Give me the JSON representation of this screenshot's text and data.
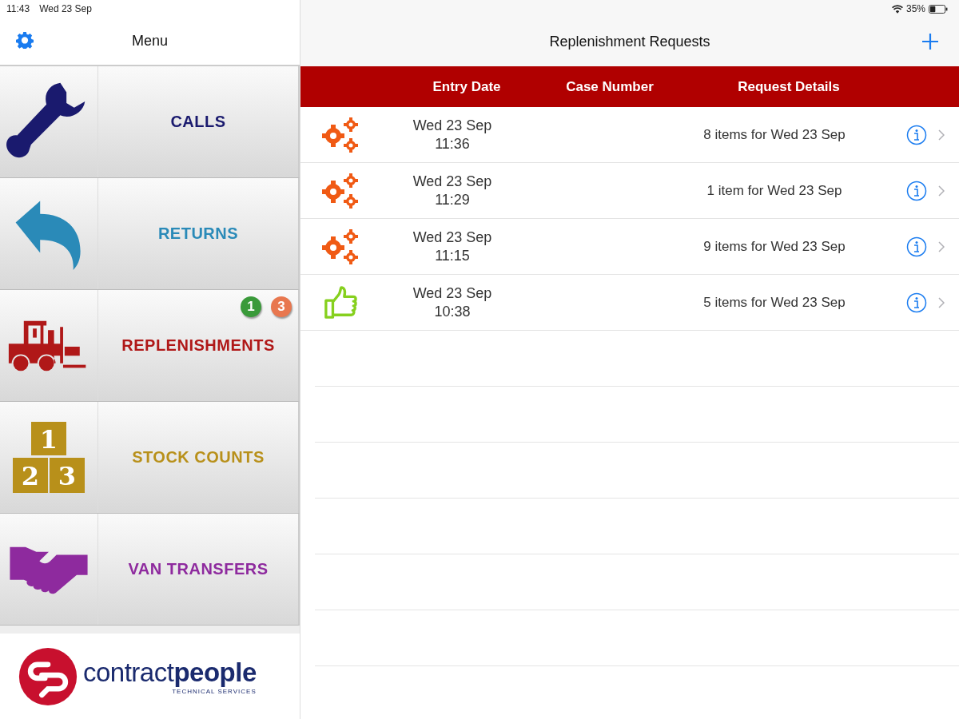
{
  "status_bar": {
    "time": "11:43",
    "date": "Wed 23 Sep",
    "battery": "35%"
  },
  "sidebar": {
    "title": "Menu",
    "items": [
      {
        "kind": "calls",
        "label": "CALLS",
        "color": "#1a1a6e"
      },
      {
        "kind": "returns",
        "label": "RETURNS",
        "color": "#2a8ab8"
      },
      {
        "kind": "replenishments",
        "label": "REPLENISHMENTS",
        "color": "#b01818",
        "badges": [
          {
            "text": "1",
            "color": "#3a9a3a"
          },
          {
            "text": "3",
            "color": "#e8774f"
          }
        ]
      },
      {
        "kind": "stock",
        "label": "STOCK COUNTS",
        "color": "#b8901a",
        "digits": [
          "1",
          "2",
          "3"
        ]
      },
      {
        "kind": "transfers",
        "label": "VAN TRANSFERS",
        "color": "#8e2a9e"
      }
    ],
    "logo": {
      "name": "contract**people**",
      "tagline": "TECHNICAL SERVICES"
    }
  },
  "main": {
    "title": "Replenishment Requests",
    "table": {
      "columns": [
        "Entry Date",
        "Case Number",
        "Request Details"
      ],
      "rows": [
        {
          "kind": "processing",
          "date": "Wed 23 Sep",
          "time": "11:36",
          "details": "8 items for Wed 23 Sep"
        },
        {
          "kind": "processing",
          "date": "Wed 23 Sep",
          "time": "11:29",
          "details": "1 item for Wed 23 Sep"
        },
        {
          "kind": "processing",
          "date": "Wed 23 Sep",
          "time": "11:15",
          "details": "9 items for Wed 23 Sep"
        },
        {
          "kind": "approved",
          "date": "Wed 23 Sep",
          "time": "10:38",
          "details": "5 items for Wed 23 Sep"
        }
      ]
    }
  }
}
